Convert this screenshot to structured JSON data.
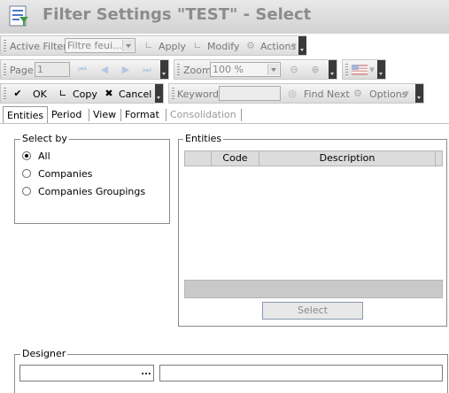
{
  "window": {
    "title": "Filter Settings \"TEST\" - Select"
  },
  "toolbar1": {
    "active_filter_label": "Active Filter",
    "filter_value": "Filtre feui...",
    "apply_label": "Apply",
    "modify_label": "Modify",
    "actions_label": "Actions"
  },
  "toolbar2": {
    "page_label": "Page",
    "page_value": "1",
    "zoom_label": "Zoom",
    "zoom_value": "100 %"
  },
  "toolbar3": {
    "ok_label": "OK",
    "copy_label": "Copy",
    "cancel_label": "Cancel",
    "keyword_label": "Keyword",
    "keyword_value": "",
    "find_next_label": "Find Next",
    "options_label": "Options"
  },
  "tabs": [
    "Entities",
    "Period",
    "View",
    "Format",
    "Consolidation"
  ],
  "select_by": {
    "legend": "Select by",
    "options": [
      "All",
      "Companies",
      "Companies Groupings"
    ],
    "selected": "All"
  },
  "entities": {
    "legend": "Entities",
    "columns": [
      "Code",
      "Description"
    ],
    "rows": [],
    "select_label": "Select"
  },
  "designer": {
    "legend": "Designer",
    "field1_value": "",
    "field2_value": "",
    "ellipsis_label": "..."
  }
}
